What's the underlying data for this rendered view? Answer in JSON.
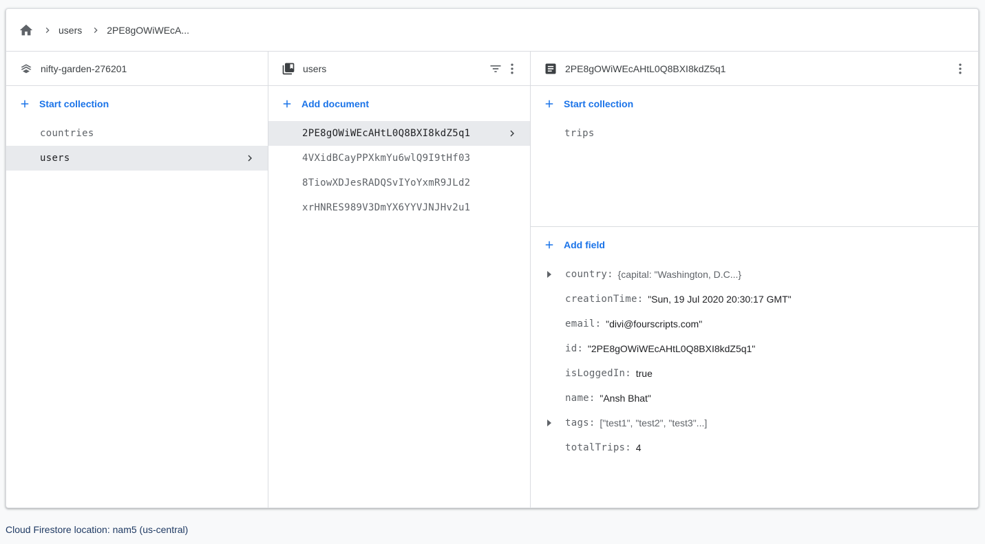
{
  "breadcrumb": {
    "items": [
      "users",
      "2PE8gOWiWEcA..."
    ]
  },
  "root_panel": {
    "title": "nifty-garden-276201",
    "action": "Start collection",
    "items": [
      {
        "label": "countries",
        "selected": false
      },
      {
        "label": "users",
        "selected": true
      }
    ]
  },
  "collection_panel": {
    "title": "users",
    "action": "Add document",
    "items": [
      {
        "label": "2PE8gOWiWEcAHtL0Q8BXI8kdZ5q1",
        "selected": true
      },
      {
        "label": "4VXidBCayPPXkmYu6wlQ9I9tHf03",
        "selected": false
      },
      {
        "label": "8TiowXDJesRADQSvIYoYxmR9JLd2",
        "selected": false
      },
      {
        "label": "xrHNRES989V3DmYX6YYVJNJHv2u1",
        "selected": false
      }
    ]
  },
  "document_panel": {
    "title": "2PE8gOWiWEcAHtL0Q8BXI8kdZ5q1",
    "collection_action": "Start collection",
    "subcollections": [
      "trips"
    ],
    "field_action": "Add field",
    "fields": [
      {
        "key": "country",
        "value": "{capital: \"Washington, D.C...}",
        "expandable": true
      },
      {
        "key": "creationTime",
        "value": "\"Sun, 19 Jul 2020 20:30:17 GMT\"",
        "expandable": false
      },
      {
        "key": "email",
        "value": "\"divi@fourscripts.com\"",
        "expandable": false
      },
      {
        "key": "id",
        "value": "\"2PE8gOWiWEcAHtL0Q8BXI8kdZ5q1\"",
        "expandable": false
      },
      {
        "key": "isLoggedIn",
        "value": "true",
        "expandable": false
      },
      {
        "key": "name",
        "value": "\"Ansh Bhat\"",
        "expandable": false
      },
      {
        "key": "tags",
        "value": "[\"test1\", \"test2\", \"test3\"...]",
        "expandable": true
      },
      {
        "key": "totalTrips",
        "value": "4",
        "expandable": false
      }
    ]
  },
  "footer": {
    "location": "Cloud Firestore location: nam5 (us-central)"
  },
  "colors": {
    "accent": "#1a73e8",
    "selected_row": "#e8eaed",
    "border": "#dadce0"
  },
  "icons": {
    "home": "home-icon",
    "project": "project-layers-icon",
    "collection": "collection-icon",
    "document": "document-icon",
    "filter": "filter-icon",
    "more": "more-vert-icon",
    "add": "plus-icon",
    "chevron": "chevron-right-icon",
    "expand": "expand-arrow-icon"
  }
}
